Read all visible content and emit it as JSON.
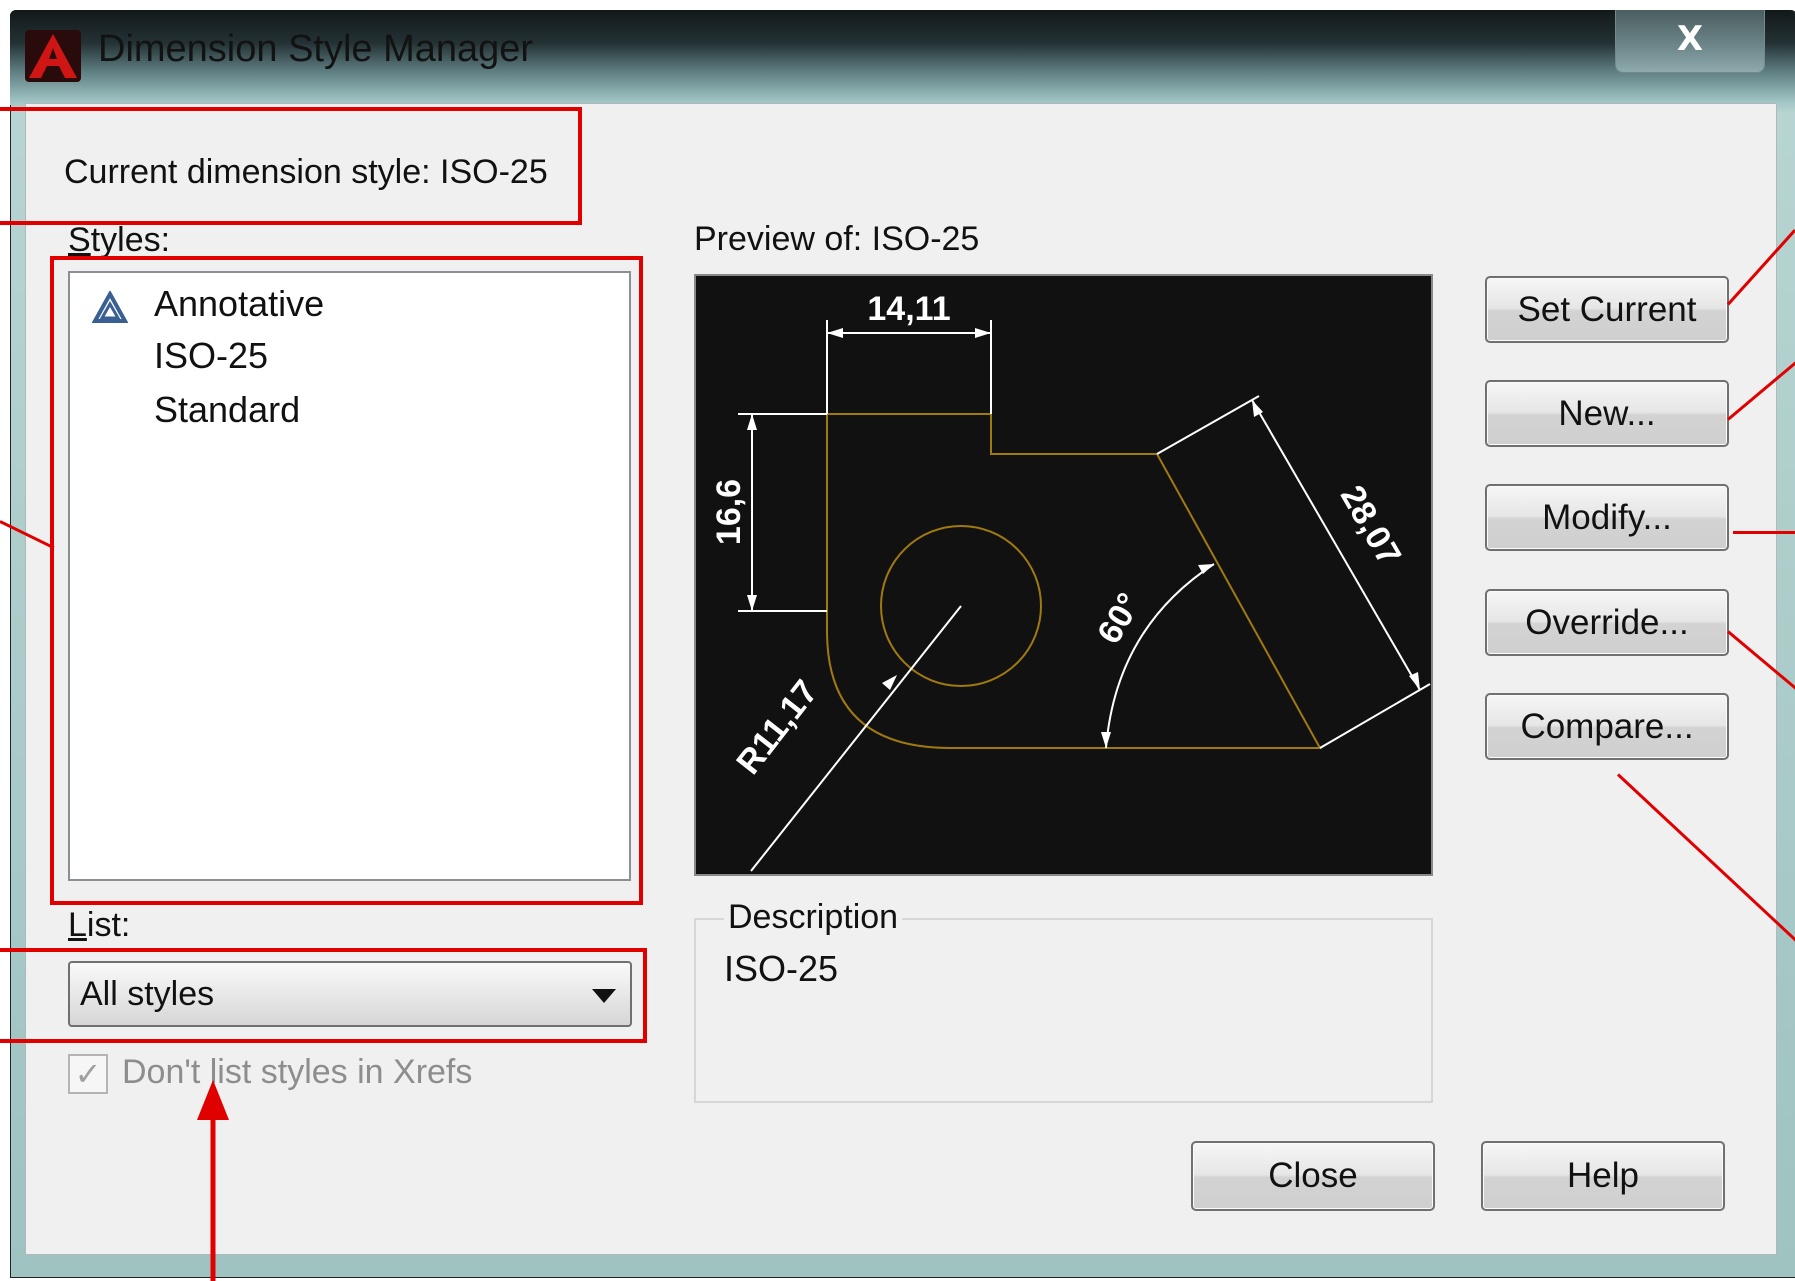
{
  "window": {
    "title": "Dimension Style Manager",
    "close_label": "X"
  },
  "current_style": {
    "label": "Current dimension style: ISO-25"
  },
  "styles": {
    "label": "Styles:",
    "items": [
      "Annotative",
      "ISO-25",
      "Standard"
    ],
    "selected": "ISO-25"
  },
  "list": {
    "label": "List:",
    "selected": "All styles"
  },
  "xrefs_checkbox": {
    "label": "Don't list styles in Xrefs",
    "checked": true,
    "mark": "✓",
    "disabled": true
  },
  "preview": {
    "label": "Preview of: ISO-25",
    "dimensions": [
      "14,11",
      "16,6",
      "28,07",
      "60°",
      "R11,17"
    ]
  },
  "description": {
    "label": "Description",
    "value": "ISO-25"
  },
  "buttons": {
    "set_current": "Set Current",
    "new": "New...",
    "modify": "Modify...",
    "override": "Override...",
    "compare": "Compare...",
    "close": "Close",
    "help": "Help"
  },
  "colors": {
    "annotation_red": "#e00000",
    "preview_bg": "#111111",
    "geometry": "#a07a10",
    "dim_lines": "#ffffff"
  },
  "icons": {
    "app": "autocad-logo-icon",
    "annotative": "annotative-icon",
    "dropdown": "chevron-down-icon"
  }
}
